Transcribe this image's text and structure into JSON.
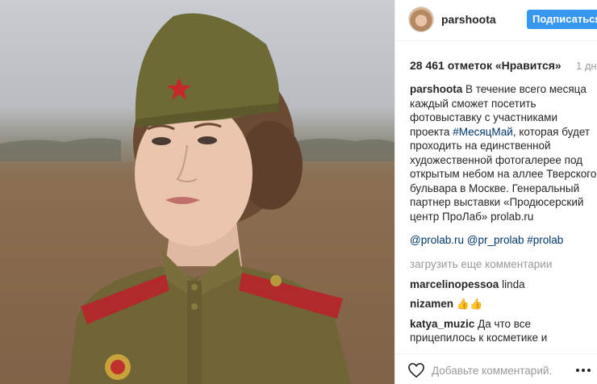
{
  "post": {
    "image_alt": "",
    "author": {
      "username": "parshoota",
      "follow_label": "Подписаться"
    },
    "likes_text": "28 461 отметок «Нравится»",
    "time_text": "1 дн",
    "caption": {
      "username": "parshoota",
      "text_1": " В течение всего месяца каждый сможет посетить фотовыставку с участниками проекта ",
      "hashtag_1": "#МесяцМай",
      "text_2": ", которая будет проходить на единственной художественной фотогалерее под открытым небом на аллее Тверского бульвара в Москве. Генеральный партнер выставки «Продюсерский центр ПроЛаб» prolab.ru",
      "mention_1": "@prolab.ru",
      "mention_2": "@pr_prolab",
      "hashtag_2": "#prolab"
    },
    "load_more_label": "загрузить еще комментарии",
    "comments": [
      {
        "username": "marcelinopessoa",
        "text": "linda"
      },
      {
        "username": "nizamen",
        "text": "👍👍"
      },
      {
        "username": "katya_muzic",
        "text": "Да что все прицепилось к косметике и маникюру? На мой взгляд, здесь в этом есть смысл, ведь суть проекта - не снять фильм о войне с участием звёзд и детальной"
      }
    ],
    "add_comment_placeholder": "Добавьте комментарий...",
    "colors": {
      "accent": "#3897f0",
      "link": "#003569",
      "muted": "#999999",
      "text": "#262626"
    },
    "icons": [
      "heart-icon",
      "more-options-icon"
    ]
  }
}
